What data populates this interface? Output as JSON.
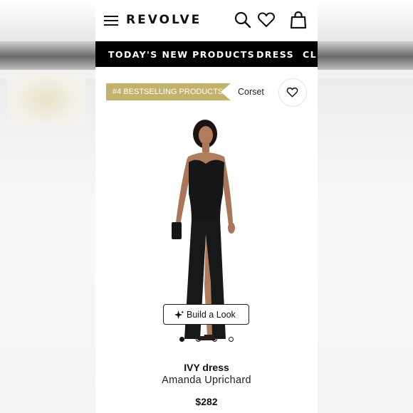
{
  "header": {
    "logo": "REVOLVE",
    "icons": [
      "menu-icon",
      "search-icon",
      "heart-icon",
      "bag-icon"
    ]
  },
  "nav": {
    "items": [
      "TODAY'S NEW PRODUCTS",
      "DRESS",
      "CL"
    ]
  },
  "badge": {
    "label": "#4 BESTSELLING PRODUCTS",
    "color": "#c3b36a"
  },
  "category": "Corset",
  "build_look": "Build a Look",
  "carousel": {
    "count": 4,
    "active": 1
  },
  "product": {
    "name": "IVY dress",
    "brand": "Amanda Uprichard",
    "price": "$282"
  }
}
